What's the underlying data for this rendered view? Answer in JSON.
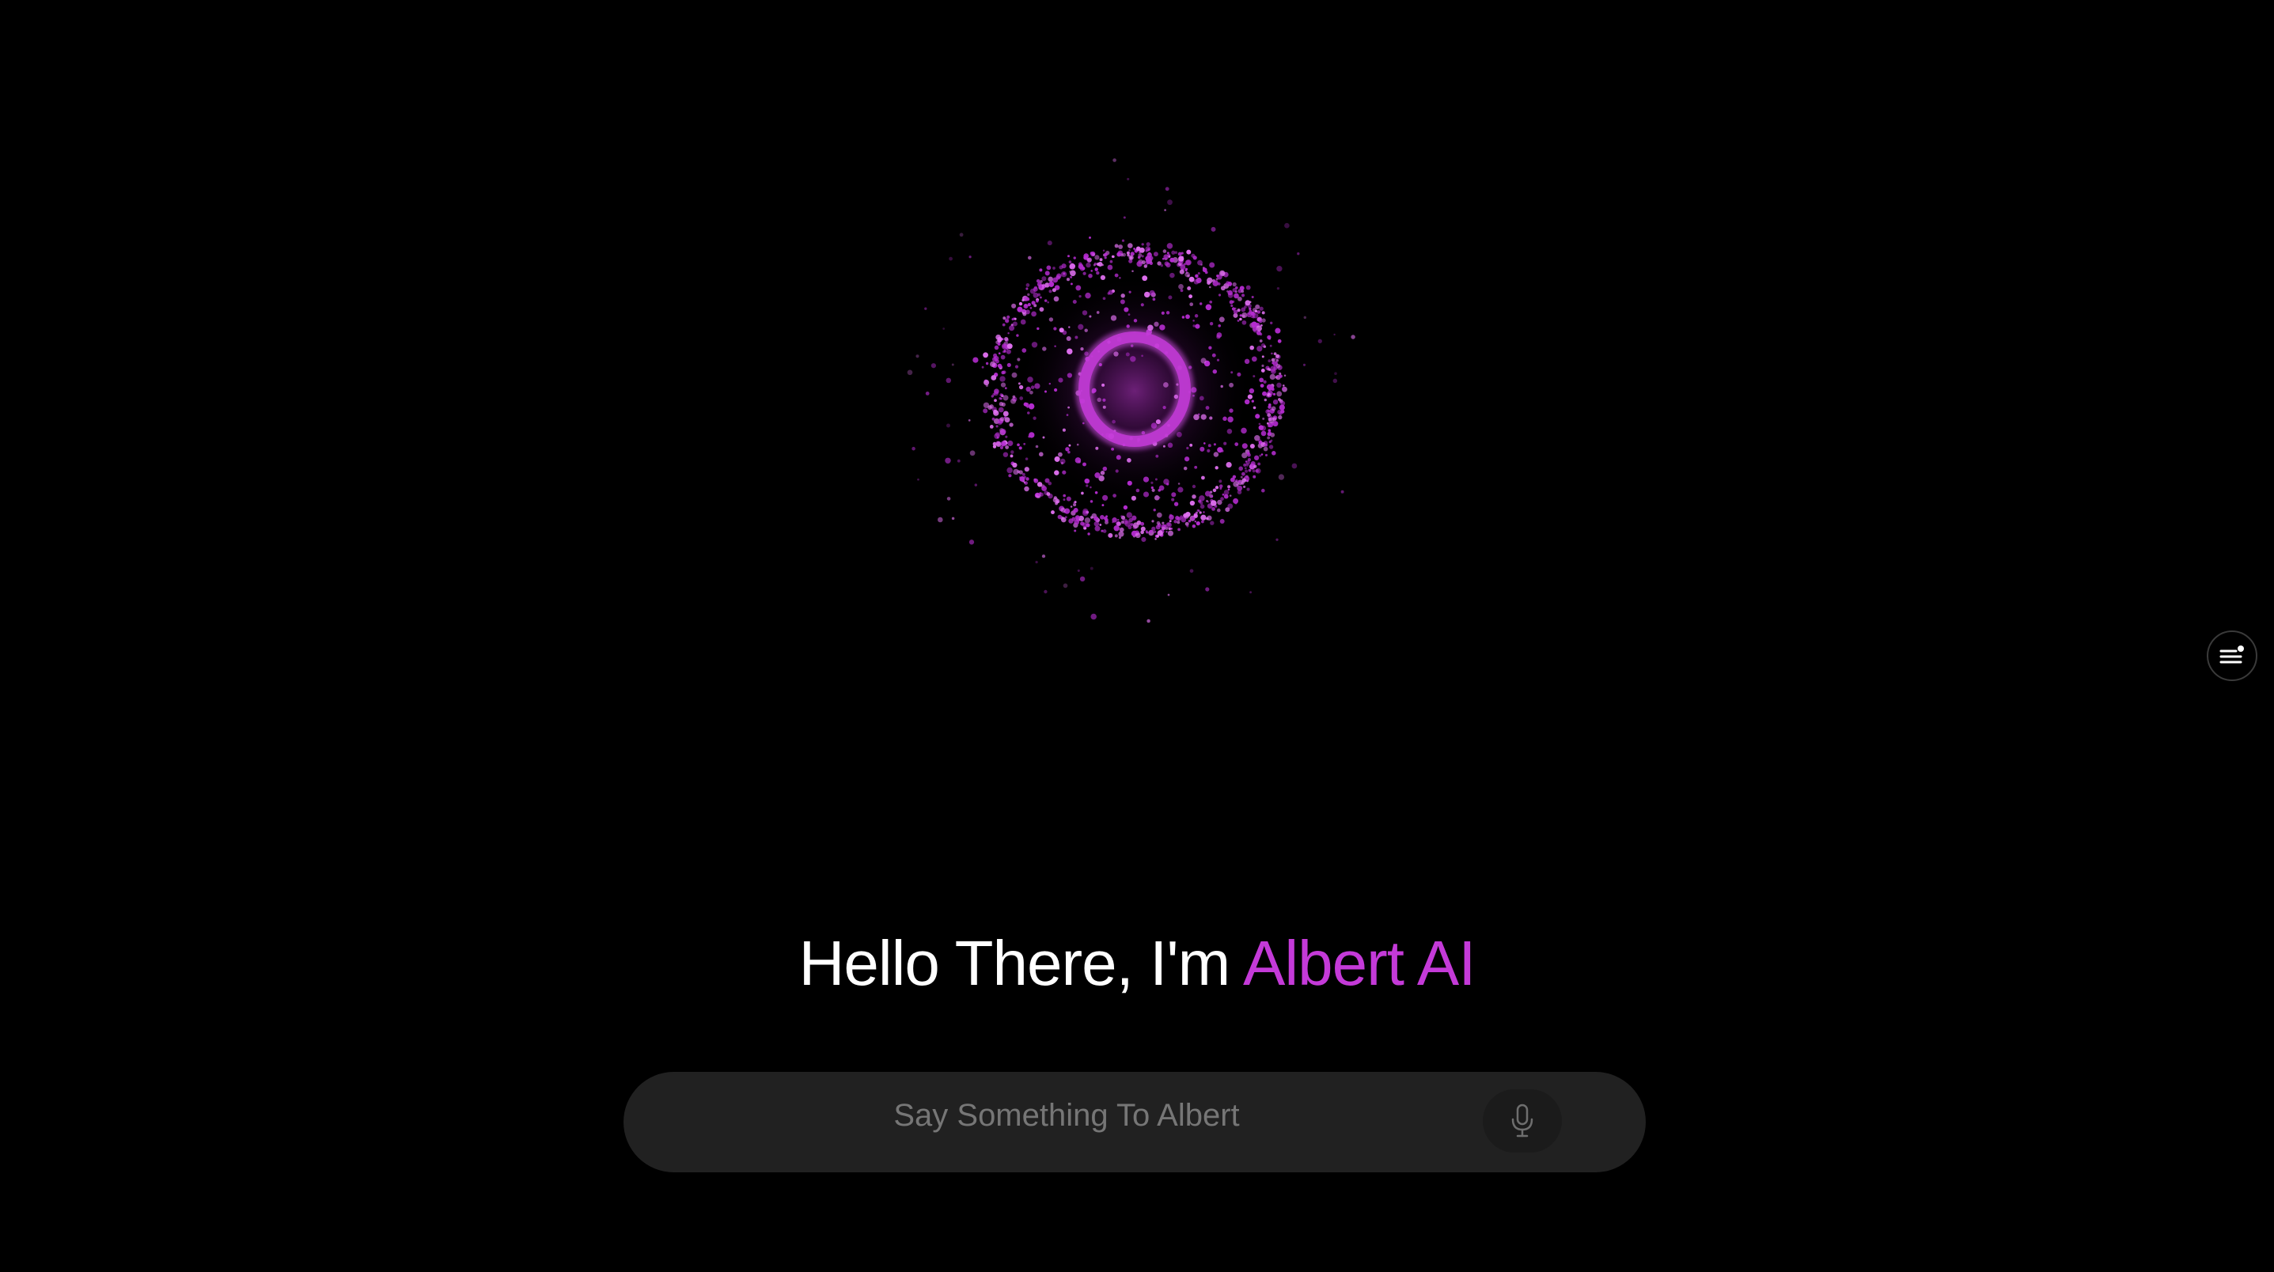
{
  "greeting": {
    "prefix": "Hello There, I'm ",
    "name": "Albert AI"
  },
  "input": {
    "placeholder": "Say Something To Albert",
    "value": ""
  },
  "icons": {
    "orb": "particle-orb-icon",
    "mic": "microphone-icon",
    "menu": "menu-notification-icon"
  },
  "colors": {
    "background": "#000000",
    "accent": "#c43ad8",
    "input_background": "#212121",
    "placeholder": "#767676"
  }
}
